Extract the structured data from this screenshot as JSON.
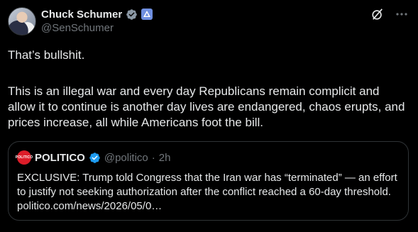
{
  "author": {
    "display_name": "Chuck Schumer",
    "handle": "@SenSchumer"
  },
  "post": {
    "line1": "That’s bullshit.",
    "line2": "This is an illegal war and every day Republicans remain complicit and allow it to continue is another day lives are endangered, chaos erupts, and prices increase, all while Americans foot the bill."
  },
  "quote": {
    "logo_text": "POLITICO",
    "display_name": "POLITICO",
    "handle": "@politico",
    "separator": "·",
    "time": "2h",
    "text": "EXCLUSIVE: Trump told Congress that the Iran war has “terminated” — an effort to justify not seeking authorization after the conflict reached a 60-day threshold. politico.com/news/2026/05/0…"
  },
  "icons": {
    "verified": "verified-badge-icon",
    "senate": "government-badge-icon",
    "grok": "grok-icon",
    "more": "more-options-icon"
  },
  "colors": {
    "background": "#000000",
    "text": "#e7e9ea",
    "muted": "#71767b",
    "verified": "#1d9bf0",
    "border": "#2f3336",
    "politico_red": "#dc1d29"
  }
}
